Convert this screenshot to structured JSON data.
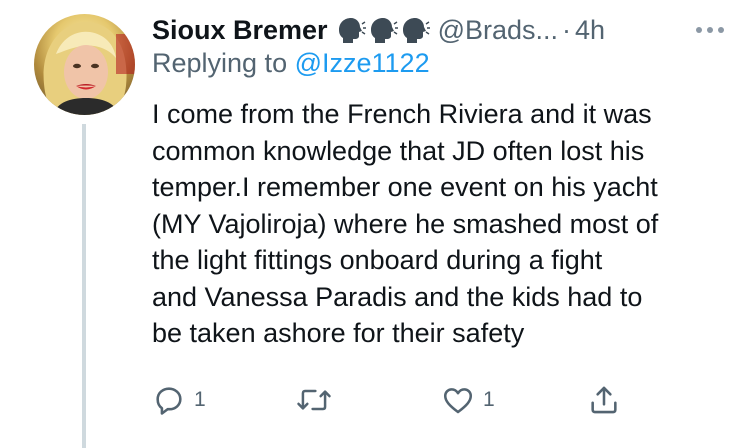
{
  "tweet": {
    "display_name": "Sioux Bremer",
    "name_emojis": [
      "speaking-head-icon",
      "speaking-head-icon",
      "speaking-head-icon"
    ],
    "handle": "@Brads...",
    "separator": "·",
    "timestamp": "4h",
    "reply_prefix": "Replying to ",
    "reply_mention": "@Izze1122",
    "body_lines": [
      "I come from the French Riviera and it was",
      "common knowledge that JD often lost his",
      "temper.I remember one event on his yacht",
      "(MY Vajoliroja) where he smashed most of",
      "the light fittings onboard during a fight",
      "and Vanessa  Paradis and the kids had to",
      "be taken ashore for their safety"
    ]
  },
  "actions": {
    "reply_count": "1",
    "retweet_count": "",
    "like_count": "1"
  },
  "colors": {
    "text": "#0f1419",
    "secondary": "#536471",
    "link": "#1d9bf0",
    "thread_line": "#cfd9de"
  }
}
